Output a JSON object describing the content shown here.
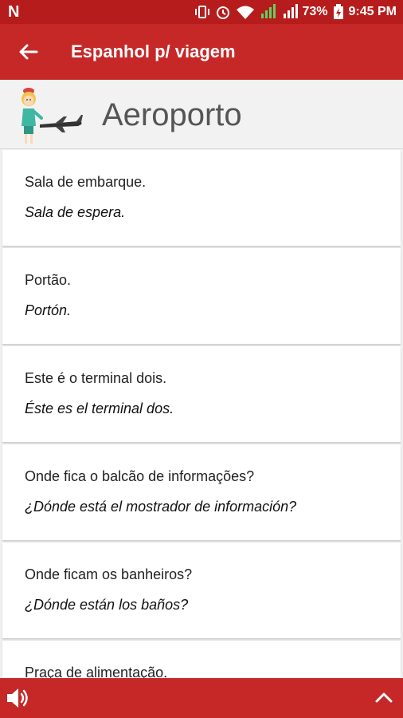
{
  "status_bar": {
    "left_icon": "N",
    "battery": "73%",
    "time": "9:45 PM"
  },
  "app_bar": {
    "title": "Espanhol p/ viagem"
  },
  "category": {
    "title": "Aeroporto"
  },
  "phrases": [
    {
      "pt": "Sala de embarque.",
      "es": "Sala de espera."
    },
    {
      "pt": "Portão.",
      "es": "Portón."
    },
    {
      "pt": "Este é o terminal dois.",
      "es": "Éste es el terminal dos."
    },
    {
      "pt": "Onde fica o balcão de informações?",
      "es": "¿Dónde está el mostrador de información?"
    },
    {
      "pt": "Onde ficam os banheiros?",
      "es": "¿Dónde están los baños?"
    },
    {
      "pt": "Praça de alimentação.",
      "es": ""
    }
  ],
  "colors": {
    "primary": "#c62828",
    "status_bar": "#b71c1c"
  },
  "icons": {
    "back": "arrow-left-icon",
    "speaker": "speaker-icon",
    "expand": "chevron-up-icon"
  }
}
